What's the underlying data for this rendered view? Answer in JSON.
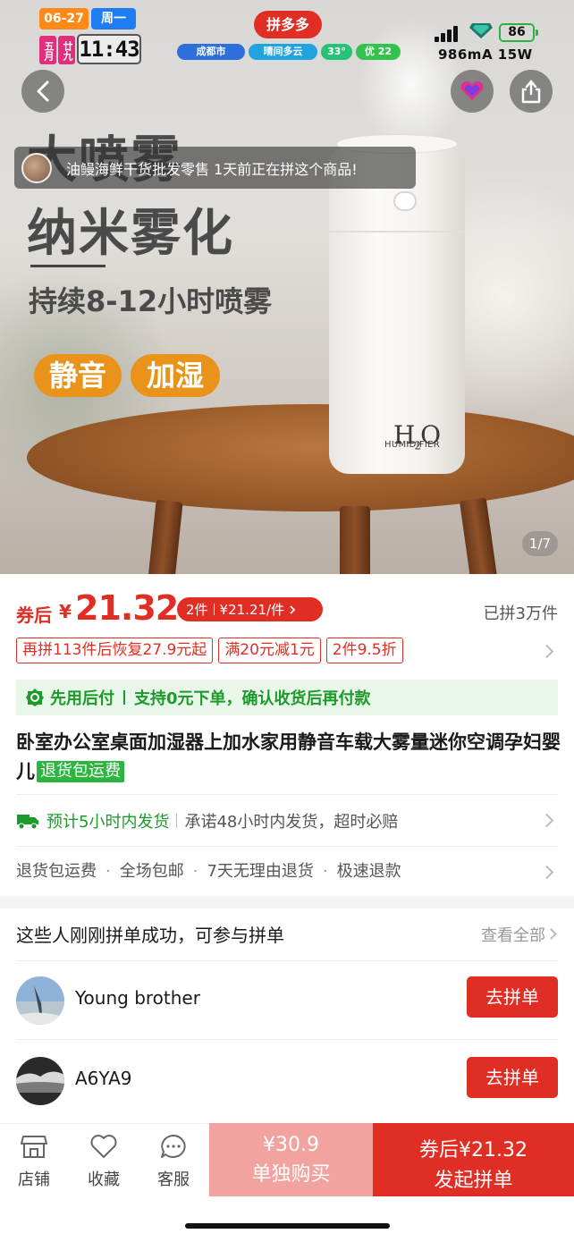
{
  "status_bar": {
    "date": "06-27",
    "weekday": "周一",
    "lunar_month": "五月",
    "lunar_day": "廿九",
    "time": "11:43",
    "app_badge": "拼多多",
    "city": "成都市",
    "weather": "晴间多云",
    "temperature": "33°",
    "air_quality": "优 22",
    "battery": "86",
    "charging": "986mA 15W"
  },
  "hero": {
    "headline_1": "大喷雾",
    "headline_2": "纳米雾化",
    "subline": "持续8-12小时喷雾",
    "tag_1": "静音",
    "tag_2": "加湿",
    "product_logo": "H2O",
    "product_logo_sub": "HUMIDIFIER",
    "toast": "油鳗海鲜干货批发零售 1天前正在拼这个商品!",
    "pager": "1/7"
  },
  "price": {
    "after_coupon_label": "券后",
    "currency": "¥",
    "value": "21.32",
    "multi_buy_qty": "2件",
    "multi_buy_price": "¥21.21/件",
    "sold": "已拼3万件"
  },
  "promotions": [
    "再拼113件后恢复27.9元起",
    "满20元减1元",
    "2件9.5折"
  ],
  "pay_later": {
    "title": "先用后付",
    "desc": "支持0元下单，确认收货后再付款"
  },
  "product": {
    "title": "卧室办公室桌面加湿器上加水家用静音车载大雾量迷你空调孕妇婴儿",
    "return_badge": "退货包运费"
  },
  "shipping": {
    "estimate": "预计5小时内发货",
    "promise": "承诺48小时内发货，超时必赔"
  },
  "services": [
    "退货包运费",
    "全场包邮",
    "7天无理由退货",
    "极速退款"
  ],
  "group": {
    "title": "这些人刚刚拼单成功，可参与拼单",
    "view_all": "查看全部",
    "join_label": "去拼单",
    "members": [
      {
        "name": "Young brother"
      },
      {
        "name": "A6YA9"
      }
    ]
  },
  "bottom_bar": {
    "store": "店铺",
    "favorite": "收藏",
    "service": "客服",
    "single_price": "¥30.9",
    "single_label": "单独购买",
    "group_price": "券后¥21.32",
    "group_label": "发起拼单"
  },
  "colors": {
    "accent": "#e02e24",
    "green": "#1c9a2a",
    "single_buy": "#f2a3a0"
  }
}
